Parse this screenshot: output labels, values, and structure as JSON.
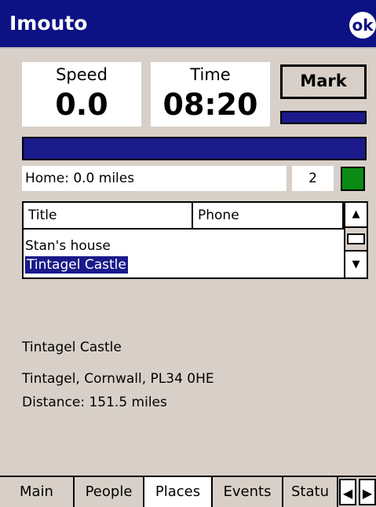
{
  "app": {
    "title": "Imouto",
    "ok_label": "ok"
  },
  "panels": {
    "speed": {
      "label": "Speed",
      "value": "0.0"
    },
    "time": {
      "label": "Time",
      "value": "08:20"
    },
    "mark_label": "Mark"
  },
  "status": {
    "home_text": "Home: 0.0 miles",
    "count": "2",
    "indicator_color": "#0b8b14"
  },
  "list": {
    "headers": [
      "Title",
      "Phone"
    ],
    "rows": [
      {
        "title": "Stan's house",
        "selected": false
      },
      {
        "title": "Tintagel Castle",
        "selected": true
      }
    ]
  },
  "detail": {
    "name": "Tintagel Castle",
    "address": "Tintagel, Cornwall, PL34 0HE",
    "distance": "Distance: 151.5 miles"
  },
  "tabs": [
    {
      "label": "Main",
      "active": false
    },
    {
      "label": "People",
      "active": false
    },
    {
      "label": "Places",
      "active": true
    },
    {
      "label": "Events",
      "active": false
    },
    {
      "label": "Statu",
      "active": false
    }
  ],
  "colors": {
    "title_bar": "#0c1184",
    "selection": "#1b1a8b",
    "background": "#d8d0c8"
  }
}
